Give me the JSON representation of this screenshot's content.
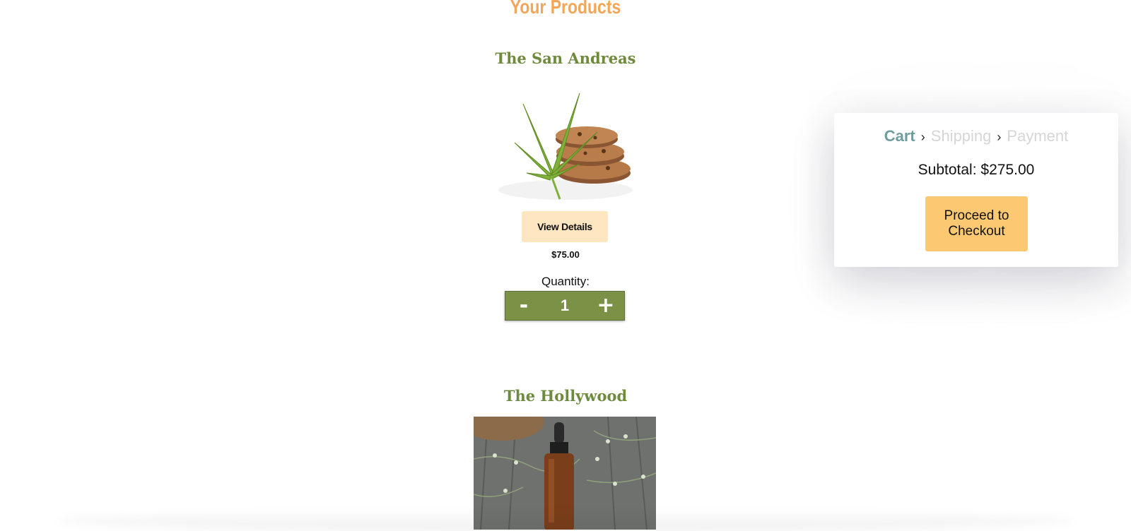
{
  "page": {
    "title": "Your Products"
  },
  "products": [
    {
      "name": "The San Andreas",
      "view_details_label": "View Details",
      "price": "$75.00",
      "quantity_label": "Quantity:",
      "quantity": "1",
      "decrement_label": "-",
      "increment_label": "+"
    },
    {
      "name": "The Hollywood"
    }
  ],
  "cart": {
    "steps": [
      {
        "label": "Cart",
        "active": true
      },
      {
        "label": "Shipping",
        "active": false
      },
      {
        "label": "Payment",
        "active": false
      }
    ],
    "separator": "›",
    "subtotal_label": "Subtotal:",
    "subtotal_value": "$275.00",
    "checkout_label": "Proceed to Checkout"
  },
  "colors": {
    "title_orange": "#f2a65a",
    "product_green": "#6e8b3d",
    "stepper_green": "#7a9146",
    "details_button": "#fde6c0",
    "checkout_button": "#fdc872",
    "active_step": "#6f9d9e",
    "inactive_step": "#d6d6d6"
  }
}
